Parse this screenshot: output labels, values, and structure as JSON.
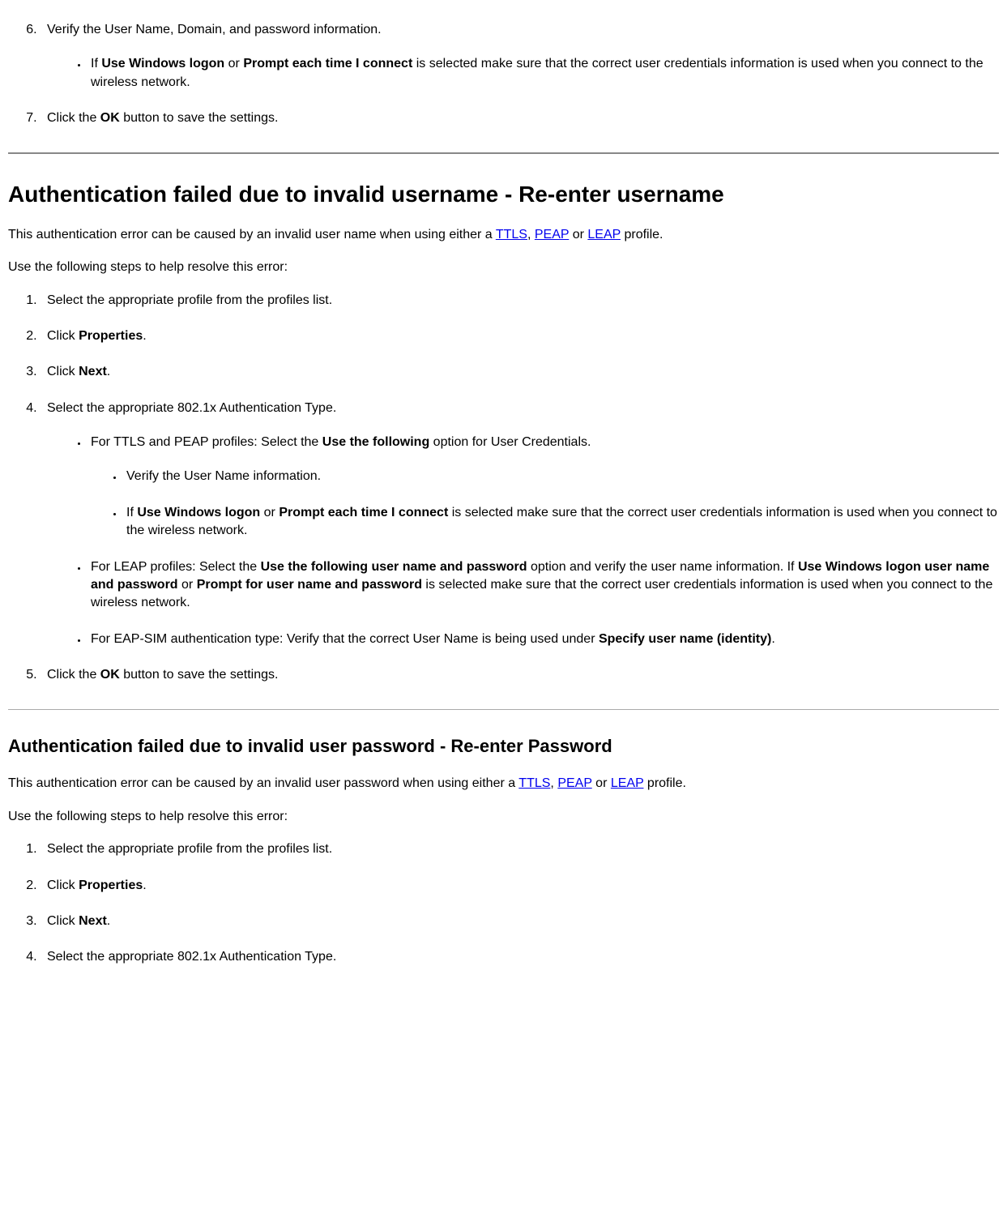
{
  "section0": {
    "ol_start": 6,
    "items": [
      {
        "text": "Verify the User Name, Domain, and password information.",
        "sub": [
          {
            "parts": [
              {
                "t": "If "
              },
              {
                "t": "Use Windows logon",
                "b": true
              },
              {
                "t": " or "
              },
              {
                "t": "Prompt each time I connect",
                "b": true
              },
              {
                "t": " is selected make sure that the correct user credentials information is used when you connect to the wireless network."
              }
            ]
          }
        ]
      },
      {
        "parts": [
          {
            "t": "Click the "
          },
          {
            "t": "OK",
            "b": true
          },
          {
            "t": " button to save the settings."
          }
        ]
      }
    ]
  },
  "section1": {
    "heading": "Authentication failed due to invalid username - Re-enter username",
    "intro_parts": [
      {
        "t": "This authentication error can be caused by an invalid user name when using either a "
      },
      {
        "t": "TTLS",
        "link": true
      },
      {
        "t": ", "
      },
      {
        "t": "PEAP",
        "link": true
      },
      {
        "t": " or "
      },
      {
        "t": "LEAP",
        "link": true
      },
      {
        "t": " profile."
      }
    ],
    "resolve": "Use the following steps to help resolve this error:",
    "steps": [
      {
        "parts": [
          {
            "t": "Select the appropriate profile from the profiles list."
          }
        ]
      },
      {
        "parts": [
          {
            "t": "Click "
          },
          {
            "t": "Properties",
            "b": true
          },
          {
            "t": "."
          }
        ]
      },
      {
        "parts": [
          {
            "t": "Click "
          },
          {
            "t": "Next",
            "b": true
          },
          {
            "t": "."
          }
        ]
      },
      {
        "parts": [
          {
            "t": "Select the appropriate 802.1x Authentication Type."
          }
        ],
        "sub": [
          {
            "parts": [
              {
                "t": "For TTLS and PEAP profiles: Select the "
              },
              {
                "t": "Use the following",
                "b": true
              },
              {
                "t": " option for User Credentials."
              }
            ],
            "sub": [
              {
                "parts": [
                  {
                    "t": "Verify the User Name information."
                  }
                ]
              },
              {
                "parts": [
                  {
                    "t": "If "
                  },
                  {
                    "t": "Use Windows logon",
                    "b": true
                  },
                  {
                    "t": " or "
                  },
                  {
                    "t": "Prompt each time I connect",
                    "b": true
                  },
                  {
                    "t": " is selected make sure that the correct user credentials information is used when you connect to the wireless network."
                  }
                ]
              }
            ]
          },
          {
            "parts": [
              {
                "t": "For LEAP profiles: Select the "
              },
              {
                "t": "Use the following user name and password",
                "b": true
              },
              {
                "t": " option and verify the user name information. If "
              },
              {
                "t": "Use Windows logon user name and password",
                "b": true
              },
              {
                "t": " or "
              },
              {
                "t": "Prompt for user name and password",
                "b": true
              },
              {
                "t": " is selected make sure that the correct user credentials information is used when you connect to the wireless network."
              }
            ]
          },
          {
            "parts": [
              {
                "t": "For EAP-SIM authentication type: Verify that the correct User Name is being used under "
              },
              {
                "t": "Specify user name (identity)",
                "b": true
              },
              {
                "t": "."
              }
            ]
          }
        ]
      },
      {
        "parts": [
          {
            "t": "Click the "
          },
          {
            "t": "OK",
            "b": true
          },
          {
            "t": " button to save the settings."
          }
        ]
      }
    ]
  },
  "section2": {
    "heading": "Authentication failed due to invalid user password - Re-enter Password",
    "intro_parts": [
      {
        "t": "This authentication error can be caused by an invalid user password when using either a "
      },
      {
        "t": "TTLS",
        "link": true
      },
      {
        "t": ", "
      },
      {
        "t": "PEAP",
        "link": true
      },
      {
        "t": " or "
      },
      {
        "t": "LEAP",
        "link": true
      },
      {
        "t": " profile."
      }
    ],
    "resolve": "Use the following steps to help resolve this error:",
    "steps": [
      {
        "parts": [
          {
            "t": "Select the appropriate profile from the profiles list."
          }
        ]
      },
      {
        "parts": [
          {
            "t": "Click "
          },
          {
            "t": "Properties",
            "b": true
          },
          {
            "t": "."
          }
        ]
      },
      {
        "parts": [
          {
            "t": "Click "
          },
          {
            "t": "Next",
            "b": true
          },
          {
            "t": "."
          }
        ]
      },
      {
        "parts": [
          {
            "t": "Select the appropriate 802.1x Authentication Type."
          }
        ]
      }
    ]
  }
}
